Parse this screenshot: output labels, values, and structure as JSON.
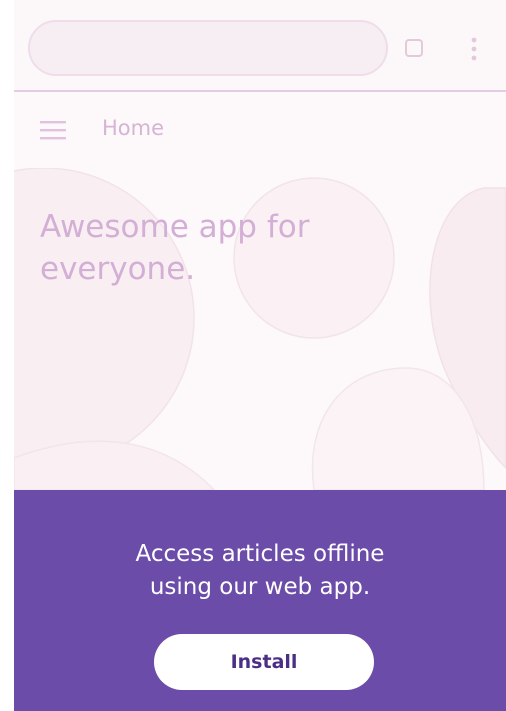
{
  "browser": {
    "url": "",
    "icons": {
      "tabs": "tab-switcher-icon",
      "menu": "overflow-menu-icon"
    }
  },
  "app_bar": {
    "menu_icon": "hamburger-icon",
    "title": "Home"
  },
  "hero": {
    "headline": "Awesome app for everyone."
  },
  "install_banner": {
    "message_line_1": "Access articles offline",
    "message_line_2": "using our web app.",
    "button_label": "Install"
  },
  "colors": {
    "banner_background": "#6b4ca9",
    "button_text": "#4b2f86",
    "hero_text": "#d3afd6",
    "title_text": "#d6b4d4"
  }
}
